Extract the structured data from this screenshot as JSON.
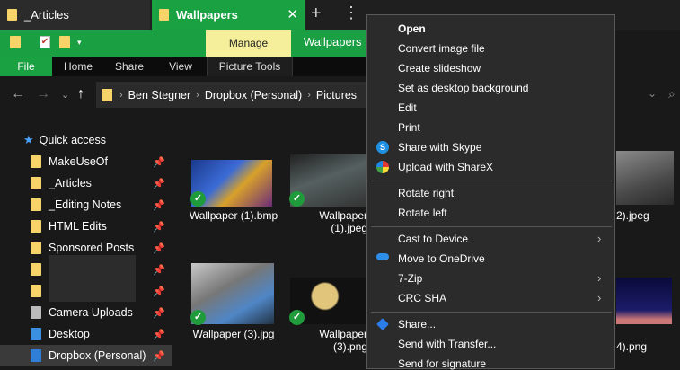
{
  "tabs": [
    {
      "label": "_Articles"
    },
    {
      "label": "Wallpapers",
      "close": "✕"
    }
  ],
  "tabbar": {
    "new_tab": "+",
    "more": "⋮"
  },
  "ribbon": {
    "manage_label": "Manage",
    "context_title": "Wallpapers",
    "tabs": [
      "File",
      "Home",
      "Share",
      "View",
      "Picture Tools"
    ]
  },
  "address": {
    "crumbs": [
      "Ben Stegner",
      "Dropbox (Personal)",
      "Pictures"
    ]
  },
  "nav_pane": {
    "quick_access": "Quick access",
    "items": [
      "MakeUseOf",
      "_Articles",
      "_Editing Notes",
      "HTML Edits",
      "Sponsored Posts",
      "",
      "",
      "Camera Uploads",
      "Desktop",
      "Dropbox (Personal)"
    ]
  },
  "files": [
    {
      "name": "Wallpaper (1).bmp"
    },
    {
      "name": "Wallpaper (1).jpeg"
    },
    {
      "name": "2).jpeg"
    },
    {
      "name": "Wallpaper (3).jpg"
    },
    {
      "name": "Wallpaper (3).png"
    },
    {
      "name": "4).png"
    }
  ],
  "context_menu": {
    "items": [
      {
        "label": "Open"
      },
      {
        "label": "Convert image file"
      },
      {
        "label": "Create slideshow"
      },
      {
        "label": "Set as desktop background"
      },
      {
        "label": "Edit"
      },
      {
        "label": "Print"
      },
      {
        "label": "Share with Skype"
      },
      {
        "label": "Upload with ShareX"
      },
      {
        "label": "Rotate right"
      },
      {
        "label": "Rotate left"
      },
      {
        "label": "Cast to Device"
      },
      {
        "label": "Move to OneDrive"
      },
      {
        "label": "7-Zip"
      },
      {
        "label": "CRC SHA"
      },
      {
        "label": "Share..."
      },
      {
        "label": "Send with Transfer..."
      },
      {
        "label": "Send for signature"
      }
    ]
  },
  "colors": {
    "accent": "#1aa142",
    "manage": "#f5ee9a",
    "folder": "#f7d46a"
  }
}
